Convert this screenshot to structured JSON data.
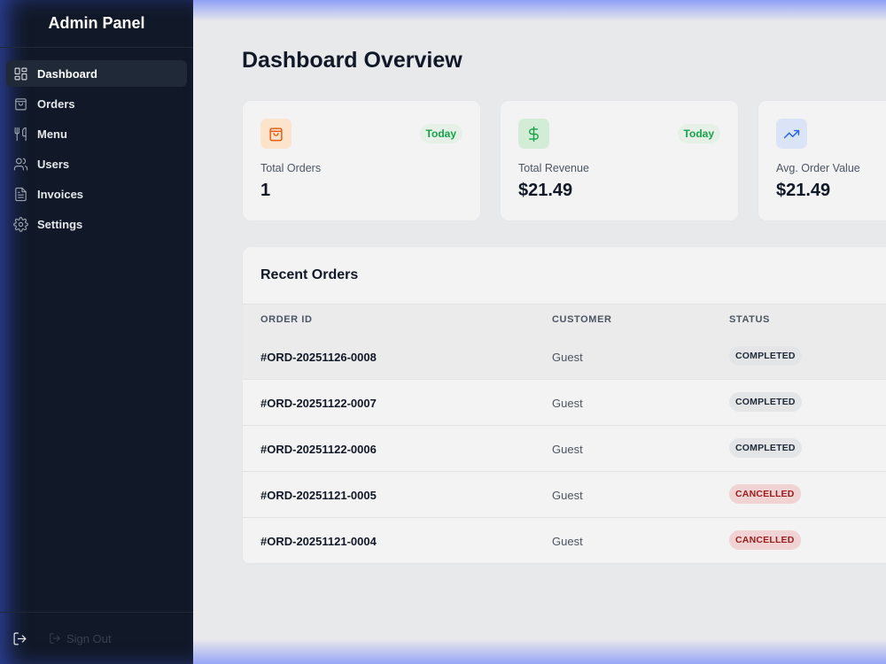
{
  "sidebar": {
    "brand": "Admin Panel",
    "items": [
      {
        "label": "Dashboard",
        "icon": "dashboard-icon",
        "active": true
      },
      {
        "label": "Orders",
        "icon": "shopping-bag-icon"
      },
      {
        "label": "Menu",
        "icon": "utensils-icon"
      },
      {
        "label": "Users",
        "icon": "users-icon"
      },
      {
        "label": "Invoices",
        "icon": "file-text-icon"
      },
      {
        "label": "Settings",
        "icon": "gear-icon"
      }
    ],
    "signout_label": "Sign Out"
  },
  "main": {
    "title": "Dashboard Overview",
    "stats": [
      {
        "label": "Total Orders",
        "value": "1",
        "badge": "Today",
        "icon": "shopping-bag-icon",
        "icon_color": "#ea580c",
        "icon_bg": "#fbe3cc"
      },
      {
        "label": "Total Revenue",
        "value": "$21.49",
        "badge": "Today",
        "icon": "dollar-icon",
        "icon_color": "#16a34a",
        "icon_bg": "#d3ecd6"
      },
      {
        "label": "Avg. Order Value",
        "value": "$21.49",
        "icon": "trending-up-icon",
        "icon_color": "#2563eb",
        "icon_bg": "#dbe4f7"
      }
    ],
    "recent_orders": {
      "title": "Recent Orders",
      "columns": [
        "ORDER ID",
        "CUSTOMER",
        "STATUS"
      ],
      "rows": [
        {
          "id": "#ORD-20251126-0008",
          "customer": "Guest",
          "status": "COMPLETED"
        },
        {
          "id": "#ORD-20251122-0007",
          "customer": "Guest",
          "status": "COMPLETED"
        },
        {
          "id": "#ORD-20251122-0006",
          "customer": "Guest",
          "status": "COMPLETED"
        },
        {
          "id": "#ORD-20251121-0005",
          "customer": "Guest",
          "status": "CANCELLED"
        },
        {
          "id": "#ORD-20251121-0004",
          "customer": "Guest",
          "status": "CANCELLED"
        }
      ]
    }
  },
  "colors": {
    "sidebar_bg": "#111827",
    "main_bg": "#e8e9eb",
    "badge_green": "#16a34a",
    "status_cancelled": "#991b1b"
  }
}
